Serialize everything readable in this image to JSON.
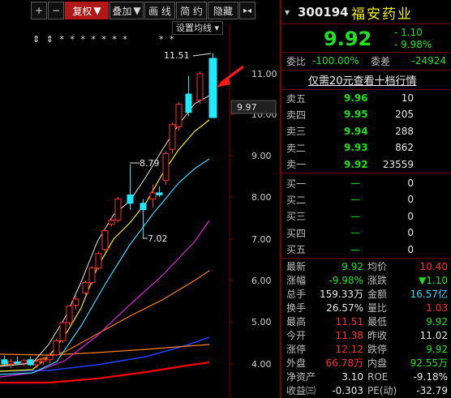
{
  "toolbar": {
    "plus": "+",
    "minus": "−",
    "fuquan": "复权",
    "fuquan_arrow": "▼",
    "diejia": "叠加",
    "diejia_arrow": "▼",
    "huaxian": "画 线",
    "jianyue": "简 约",
    "yincang": "隐藏",
    "expand": "▸◂"
  },
  "ma_setting": "设置均线",
  "ma_setting_arrow": "▾",
  "price_labels": [
    "11.00",
    "10.00",
    "9.00",
    "8.00",
    "7.00",
    "6.00",
    "5.00",
    "4.00"
  ],
  "current_price_tag": "9.97",
  "annotations": {
    "high_label": "11.51",
    "mid_high_label": "8.79",
    "low_label": "7.02",
    "event_markers": "⇕ ⇕ * * * * * * *",
    "event_markers2": "* *"
  },
  "colors": {
    "up": "#ff3030",
    "down": "#20e8ff",
    "ma5": "#e8e8e8",
    "ma10": "#f0f000",
    "ma20": "#30d8ff",
    "ma30": "#e020e0",
    "ma60": "#ff8020",
    "ma120": "#2040ff",
    "ma250": "#ff0000"
  },
  "quote": {
    "code": "300194",
    "name": "福安药业",
    "price": "9.92",
    "change": "- 1.10",
    "change_pct": "- 9.98%",
    "weibi_label": "委比",
    "weibi_value": "-100.00%",
    "weicha_label": "委差",
    "weicha_value": "-24924",
    "promo": "仅需20元查看十档行情",
    "asks": [
      {
        "label": "卖五",
        "price": "9.96",
        "vol": "10"
      },
      {
        "label": "卖四",
        "price": "9.95",
        "vol": "205"
      },
      {
        "label": "卖三",
        "price": "9.94",
        "vol": "288"
      },
      {
        "label": "卖二",
        "price": "9.93",
        "vol": "862"
      },
      {
        "label": "卖一",
        "price": "9.92",
        "vol": "23559"
      }
    ],
    "bids": [
      {
        "label": "买一",
        "price": "—",
        "vol": "0"
      },
      {
        "label": "买二",
        "price": "—",
        "vol": "0"
      },
      {
        "label": "买三",
        "price": "—",
        "vol": "0"
      },
      {
        "label": "买四",
        "price": "—",
        "vol": "0"
      },
      {
        "label": "买五",
        "price": "—",
        "vol": "0"
      }
    ],
    "stats": [
      {
        "l1": "最新",
        "v1": "9.92",
        "c1": "green",
        "l2": "均价",
        "v2": "10.40",
        "c2": "red"
      },
      {
        "l1": "涨幅",
        "v1": "-9.98%",
        "c1": "green",
        "l2": "涨跌",
        "v2": "▼1.10",
        "c2": "green"
      },
      {
        "l1": "总手",
        "v1": "159.33万",
        "c1": "white",
        "l2": "金额",
        "v2": "16.57亿",
        "c2": "cyan"
      },
      {
        "l1": "换手",
        "v1": "26.57%",
        "c1": "white",
        "l2": "量比",
        "v2": "1.03",
        "c2": "red"
      },
      {
        "l1": "最高",
        "v1": "11.51",
        "c1": "red",
        "l2": "最低",
        "v2": "9.92",
        "c2": "green"
      },
      {
        "l1": "今开",
        "v1": "11.38",
        "c1": "red",
        "l2": "昨收",
        "v2": "11.02",
        "c2": "white"
      },
      {
        "l1": "涨停",
        "v1": "12.12",
        "c1": "red",
        "l2": "跌停",
        "v2": "9.92",
        "c2": "green"
      },
      {
        "l1": "外盘",
        "v1": "66.78万",
        "c1": "red",
        "l2": "内盘",
        "v2": "92.55万",
        "c2": "green"
      },
      {
        "l1": "净资产",
        "v1": "3.10",
        "c1": "white",
        "l2": "ROE",
        "v2": "-9.18%",
        "c2": "white"
      },
      {
        "l1": "收益㈢",
        "v1": "-0.303",
        "c1": "white",
        "l2": "PE(动)",
        "v2": "-32.79",
        "c2": "white"
      }
    ]
  }
}
